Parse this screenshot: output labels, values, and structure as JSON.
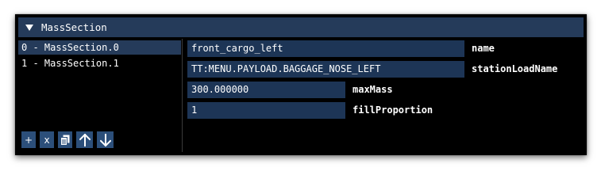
{
  "section": {
    "title": "MassSection"
  },
  "list": {
    "items": [
      {
        "label": "0 - MassSection.0",
        "selected": true
      },
      {
        "label": "1 - MassSection.1",
        "selected": false
      }
    ]
  },
  "toolbar": {
    "add_label": "+",
    "remove_label": "x",
    "icons": [
      "copy-icon",
      "arrow-up-icon",
      "arrow-down-icon"
    ]
  },
  "properties": [
    {
      "value": "front_cargo_left",
      "label": "name"
    },
    {
      "value": "TT:MENU.PAYLOAD.BAGGAGE_NOSE_LEFT",
      "label": "stationLoadName"
    },
    {
      "value": "300.000000",
      "label": "maxMass"
    },
    {
      "value": "1",
      "label": "fillProportion"
    }
  ],
  "colors": {
    "header_bg": "#253b5a",
    "field_bg": "#1d3556",
    "button_bg": "#2c4f7a",
    "panel_bg": "#000000",
    "text": "#ffffff"
  }
}
